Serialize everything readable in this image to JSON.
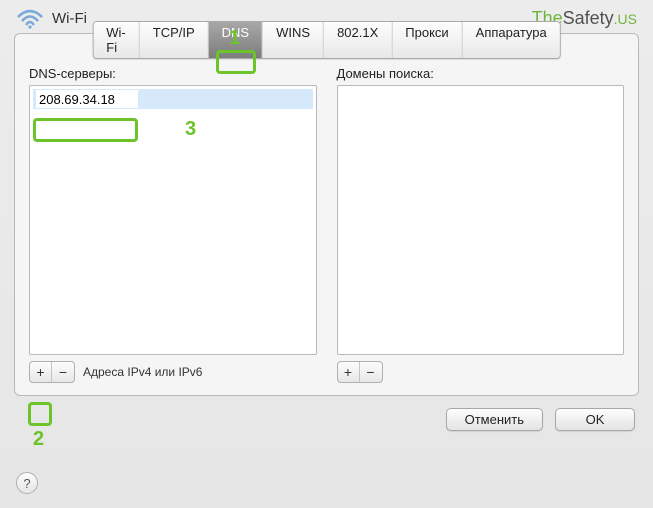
{
  "header": {
    "title": "Wi-Fi",
    "brand_part1": "The",
    "brand_part2": "Safety",
    "brand_part3": ".US"
  },
  "tabs": {
    "t0": "Wi-Fi",
    "t1": "TCP/IP",
    "t2": "DNS",
    "t3": "WINS",
    "t4": "802.1X",
    "t5": "Прокси",
    "t6": "Аппаратура"
  },
  "left": {
    "label": "DNS-серверы:",
    "entry_value": "208.69.34.18",
    "hint": "Адреса IPv4 или IPv6"
  },
  "right": {
    "label": "Домены поиска:"
  },
  "buttons": {
    "plus": "+",
    "minus": "−",
    "help": "?",
    "cancel": "Отменить",
    "ok": "OK"
  },
  "markers": {
    "m1": "1",
    "m2": "2",
    "m3": "3"
  }
}
